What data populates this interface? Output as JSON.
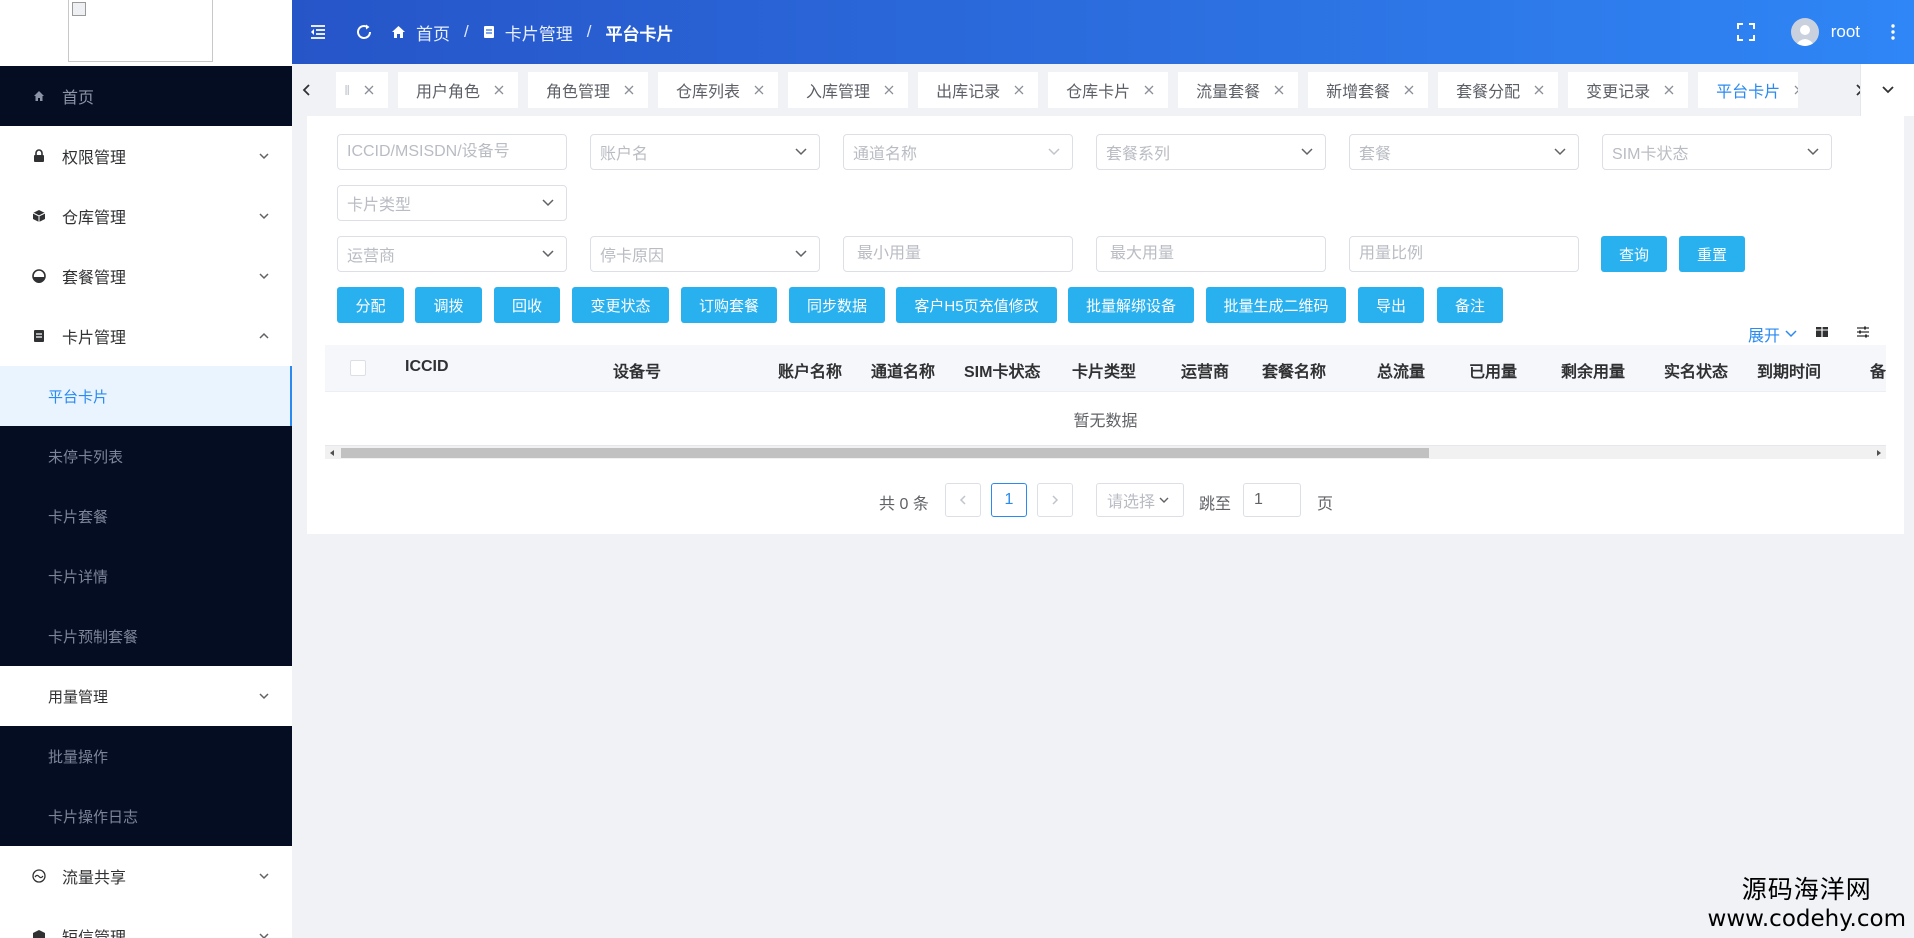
{
  "sidebar": {
    "items": [
      {
        "label": "首页",
        "icon": "home-icon"
      },
      {
        "label": "权限管理",
        "icon": "lock-icon"
      },
      {
        "label": "仓库管理",
        "icon": "box-icon"
      },
      {
        "label": "套餐管理",
        "icon": "gauge-icon"
      },
      {
        "label": "卡片管理",
        "icon": "card-icon"
      }
    ],
    "card_sub": [
      "平台卡片",
      "未停卡列表",
      "卡片套餐",
      "卡片详情",
      "卡片预制套餐"
    ],
    "usage": {
      "label": "用量管理"
    },
    "usage_sub": [
      "批量操作",
      "卡片操作日志"
    ],
    "bottom_items": [
      {
        "label": "流量共享",
        "icon": "share-icon"
      },
      {
        "label": "短信管理",
        "icon": "sms-icon"
      }
    ]
  },
  "header": {
    "breadcrumbs": [
      "首页",
      "卡片管理",
      "平台卡片"
    ],
    "user": "root"
  },
  "tabs": {
    "items": [
      "用户角色",
      "角色管理",
      "仓库列表",
      "入库管理",
      "出库记录",
      "仓库卡片",
      "流量套餐",
      "新增套餐",
      "套餐分配",
      "变更记录",
      "平台卡片"
    ],
    "active": "平台卡片"
  },
  "filters": {
    "row1": [
      "ICCID/MSISDN/设备号",
      "账户名",
      "通道名称",
      "套餐系列",
      "套餐",
      "SIM卡状态"
    ],
    "row2": [
      "卡片类型"
    ],
    "row3": [
      "运营商",
      "停卡原因",
      "最小用量",
      "最大用量",
      "用量比例"
    ],
    "search_btn": "查询",
    "reset_btn": "重置"
  },
  "actions": [
    "分配",
    "调拨",
    "回收",
    "变更状态",
    "订购套餐",
    "同步数据",
    "客户H5页充值修改",
    "批量解绑设备",
    "批量生成二维码",
    "导出",
    "备注"
  ],
  "table": {
    "expand": "展开",
    "columns": [
      "ICCID",
      "设备号",
      "账户名称",
      "通道名称",
      "SIM卡状态",
      "卡片类型",
      "运营商",
      "套餐名称",
      "总流量",
      "已用量",
      "剩余用量",
      "实名状态",
      "到期时间",
      "备"
    ],
    "empty": "暂无数据"
  },
  "pagination": {
    "total_prefix": "共",
    "total": "0",
    "total_suffix": "条",
    "current_page": "1",
    "size_placeholder": "请选择",
    "jump_label": "跳至",
    "jump_value": "1",
    "page_label": "页"
  },
  "watermark": {
    "line1": "源码海洋网",
    "line2": "www.codehy.com"
  },
  "colors": {
    "accent": "#2a8af0",
    "button": "#29b0ef",
    "sidebar_dark": "#040d21"
  }
}
